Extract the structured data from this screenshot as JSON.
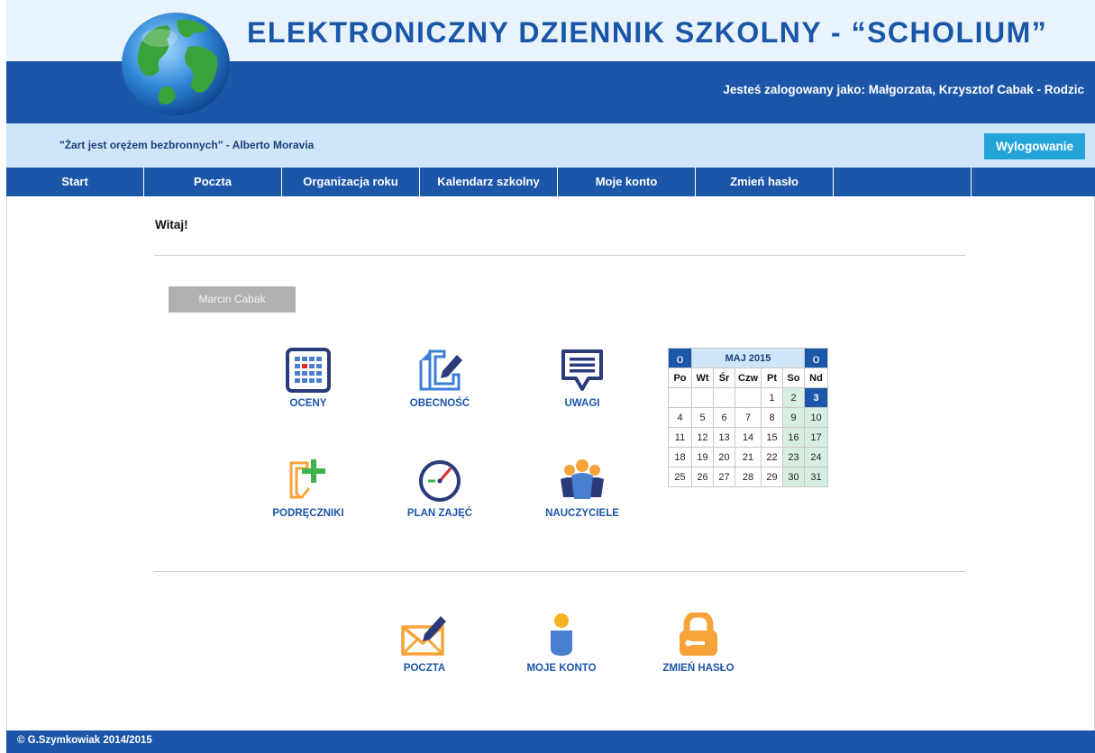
{
  "header": {
    "title": "ELEKTRONICZNY DZIENNIK SZKOLNY - “SCHOLIUM”",
    "user_info": "Jesteś zalogowany jako: Małgorzata, Krzysztof Cabak - Rodzic",
    "logo_icon": "globe-icon"
  },
  "quote_bar": {
    "quote": "\"Żart jest orężem bezbronnych\" - Alberto Moravia",
    "logout_label": "Wylogowanie"
  },
  "nav": {
    "items": [
      "Start",
      "Poczta",
      "Organizacja roku",
      "Kalendarz szkolny",
      "Moje konto",
      "Zmień hasło",
      "",
      ""
    ]
  },
  "main": {
    "welcome": "Witaj!",
    "student_button": "Marcin Cabak",
    "tiles": [
      {
        "label": "OCENY",
        "icon": "grades-grid-icon"
      },
      {
        "label": "OBECNOŚĆ",
        "icon": "attendance-pen-icon"
      },
      {
        "label": "UWAGI",
        "icon": "remarks-speech-bubble-icon"
      },
      {
        "label": "PODRĘCZNIKI",
        "icon": "textbooks-add-icon"
      },
      {
        "label": "PLAN ZAJĘĆ",
        "icon": "schedule-clock-icon"
      },
      {
        "label": "NAUCZYCIELE",
        "icon": "teachers-group-icon"
      }
    ],
    "bottom_tiles": [
      {
        "label": "POCZTA",
        "icon": "mail-envelope-icon"
      },
      {
        "label": "MOJE KONTO",
        "icon": "account-person-icon"
      },
      {
        "label": "ZMIEŃ HASŁO",
        "icon": "padlock-icon"
      }
    ]
  },
  "calendar": {
    "prev": "o",
    "next": "o",
    "title": "MAJ 2015",
    "weekdays": [
      "Po",
      "Wt",
      "Śr",
      "Czw",
      "Pt",
      "So",
      "Nd"
    ],
    "weeks": [
      [
        "",
        "",
        "",
        "",
        "1",
        "2",
        "3"
      ],
      [
        "4",
        "5",
        "6",
        "7",
        "8",
        "9",
        "10"
      ],
      [
        "11",
        "12",
        "13",
        "14",
        "15",
        "16",
        "17"
      ],
      [
        "18",
        "19",
        "20",
        "21",
        "22",
        "23",
        "24"
      ],
      [
        "25",
        "26",
        "27",
        "28",
        "29",
        "30",
        "31"
      ]
    ],
    "today": "3",
    "colors": {
      "header": "#1b56a8",
      "weekend": "#d7efe3",
      "title_bg": "#cfe6f8"
    }
  },
  "footer": {
    "text": "© G.Szymkowiak 2014/2015"
  },
  "colors": {
    "brand_blue": "#1b56a8",
    "light_blue": "#cfe6f8",
    "accent_cyan": "#24a5d9",
    "orange": "#f6a33a"
  }
}
